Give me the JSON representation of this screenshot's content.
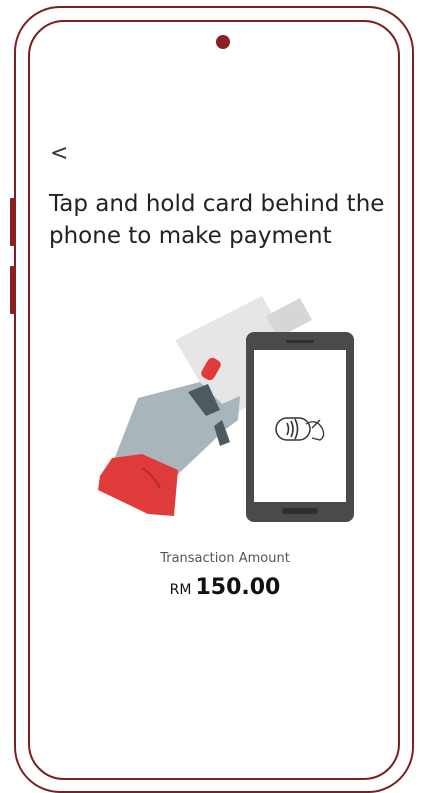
{
  "header": {
    "back_label": "<"
  },
  "main": {
    "title": "Tap and hold card behind the phone to make payment",
    "illustration": {
      "icons": [
        "hand-icon",
        "card-icon",
        "phone-icon",
        "contactless-icon"
      ]
    },
    "transaction": {
      "label": "Transaction Amount",
      "currency": "RM",
      "amount": "150.00"
    }
  },
  "colors": {
    "frame": "#7a1f23",
    "accent": "#e03b3b",
    "hand": "#a8b6bc",
    "phone_body": "#4a4a4a",
    "card": "#e6e6e6"
  }
}
